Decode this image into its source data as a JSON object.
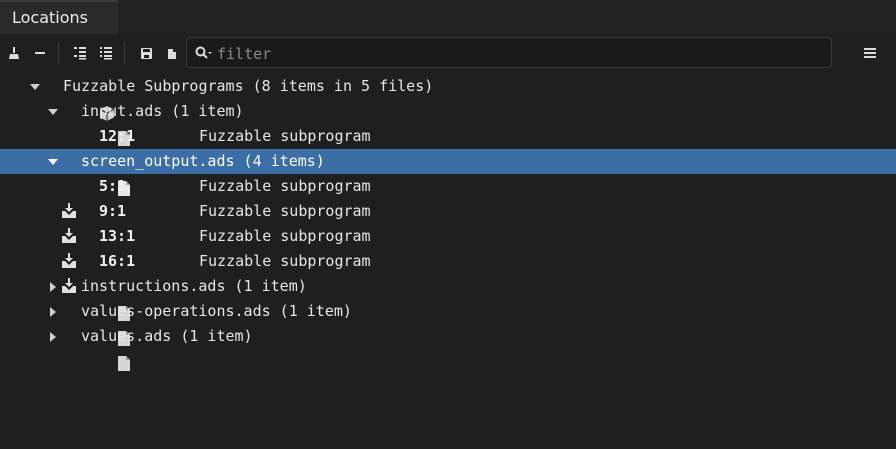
{
  "tab": {
    "label": "Locations"
  },
  "filter": {
    "placeholder": "filter",
    "value": ""
  },
  "tree": {
    "root": {
      "label": "Fuzzable Subprograms (8 items in 5 files)"
    },
    "files": [
      {
        "label": "input.ads (1 item)",
        "expanded": true,
        "items": [
          {
            "loc": "12:1",
            "message": "Fuzzable subprogram"
          }
        ]
      },
      {
        "label": "screen_output.ads (4 items)",
        "expanded": true,
        "selected": true,
        "items": [
          {
            "loc": "5:1",
            "message": "Fuzzable subprogram"
          },
          {
            "loc": "9:1",
            "message": "Fuzzable subprogram"
          },
          {
            "loc": "13:1",
            "message": "Fuzzable subprogram"
          },
          {
            "loc": "16:1",
            "message": "Fuzzable subprogram"
          }
        ]
      },
      {
        "label": "instructions.ads (1 item)",
        "expanded": false,
        "items": []
      },
      {
        "label": "values-operations.ads (1 item)",
        "expanded": false,
        "items": []
      },
      {
        "label": "values.ads (1 item)",
        "expanded": false,
        "items": []
      }
    ]
  },
  "colors": {
    "selection": "#3a6ea5",
    "background": "#1f1f1f"
  }
}
